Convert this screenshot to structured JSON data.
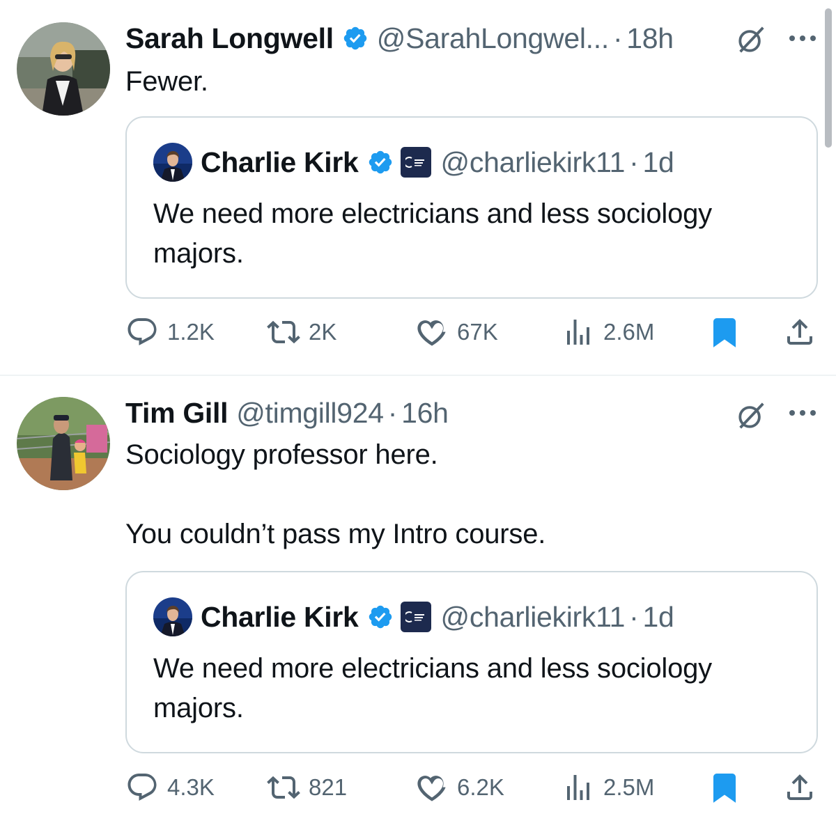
{
  "colors": {
    "text": "#0f1419",
    "secondary": "#536471",
    "verified": "#1d9bf0",
    "bookmark_active": "#1d9bf0",
    "border": "#cfd9de"
  },
  "tweets": [
    {
      "author": {
        "name": "Sarah Longwell",
        "handle": "@SarahLongwel...",
        "verified": true
      },
      "time": "18h",
      "text": "Fewer.",
      "quote": {
        "author": {
          "name": "Charlie Kirk",
          "handle": "@charliekirk11",
          "verified": true,
          "affiliation_icon": "organization-badge-icon"
        },
        "time": "1d",
        "text": "We need more electricians and less sociology majors."
      },
      "stats": {
        "replies": "1.2K",
        "retweets": "2K",
        "likes": "67K",
        "views": "2.6M",
        "bookmarked": true
      }
    },
    {
      "author": {
        "name": "Tim Gill",
        "handle": "@timgill924",
        "verified": false
      },
      "time": "16h",
      "text": "Sociology professor here.\n\nYou couldn’t pass my Intro course.",
      "quote": {
        "author": {
          "name": "Charlie Kirk",
          "handle": "@charliekirk11",
          "verified": true,
          "affiliation_icon": "organization-badge-icon"
        },
        "time": "1d",
        "text": "We need more electricians and less sociology majors."
      },
      "stats": {
        "replies": "4.3K",
        "retweets": "821",
        "likes": "6.2K",
        "views": "2.5M",
        "bookmarked": true
      }
    }
  ],
  "separator": "·"
}
